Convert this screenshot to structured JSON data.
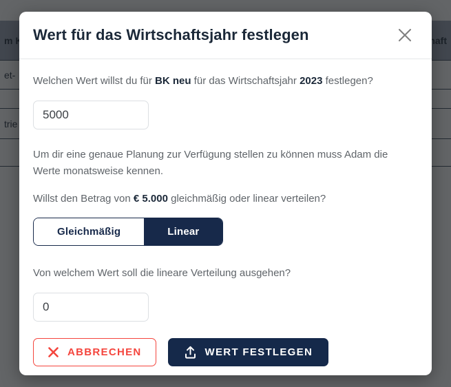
{
  "background": {
    "rows": [
      {
        "cells": [
          "m K",
          "haft"
        ]
      },
      {
        "cells": [
          "et- ",
          ""
        ]
      },
      {
        "cells": [
          "",
          ""
        ]
      },
      {
        "cells": [
          "trie",
          ""
        ]
      },
      {
        "cells": [
          "",
          ""
        ]
      }
    ]
  },
  "modal": {
    "title": "Wert für das Wirtschaftsjahr festlegen",
    "close_icon": "close-icon",
    "question": {
      "prefix": "Welchen Wert willst du für ",
      "bold_name": "BK neu",
      "middle": " für das Wirtschaftsjahr ",
      "bold_year": "2023",
      "suffix": " festlegen?"
    },
    "value_input": {
      "value": "5000",
      "placeholder": ""
    },
    "explanation": "Um dir eine genaue Planung zur Verfügung stellen zu können muss Adam die Werte monatsweise kennen.",
    "distribution_question": {
      "prefix": "Willst den Betrag von ",
      "bold_amount": "€ 5.000",
      "suffix": " gleichmäßig oder linear verteilen?"
    },
    "distribution_options": [
      {
        "label": "Gleichmäßig",
        "selected": false
      },
      {
        "label": "Linear",
        "selected": true
      }
    ],
    "start_value_question": "Von welchem Wert soll die lineare Verteilung ausgehen?",
    "start_value_input": {
      "value": "0",
      "placeholder": ""
    },
    "actions": {
      "cancel_label": "ABBRECHEN",
      "cancel_icon": "x-icon",
      "submit_label": "WERT FESTLEGEN",
      "submit_icon": "upload-icon"
    }
  },
  "colors": {
    "navy": "#15294a",
    "red": "#f4453d",
    "text_muted": "#5f6469",
    "border": "#dcdfe3"
  }
}
